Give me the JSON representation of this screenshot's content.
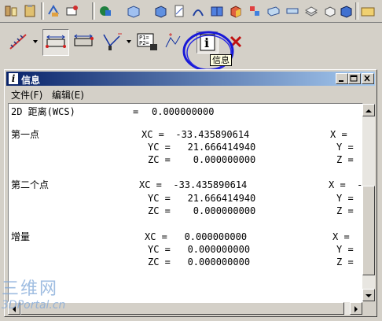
{
  "tooltip": {
    "text": "信息"
  },
  "window": {
    "title": "信息",
    "title_icon": "i",
    "menu": [
      "文件(F)",
      "编辑(E)"
    ]
  },
  "report": {
    "distance": {
      "label": "2D 距离(WCS)",
      "eq": "=",
      "value": "0.000000000"
    },
    "first_point": {
      "label": "第一点",
      "xc": "XC =  -33.435890614",
      "yc": "YC =   21.666414940",
      "zc": "ZC =    0.000000000",
      "x": "X =",
      "y": "Y =",
      "z": "Z ="
    },
    "second_point": {
      "label": "第二个点",
      "xc": "XC =  -33.435890614",
      "yc": "YC =   21.666414940",
      "zc": "ZC =    0.000000000",
      "x": "X =  -",
      "y": "Y =",
      "z": "Z ="
    },
    "delta": {
      "label": "增量",
      "xc": "XC =   0.000000000",
      "yc": "YC =   0.000000000",
      "zc": "ZC =   0.000000000",
      "x": "X =",
      "y": "Y =",
      "z": "Z ="
    }
  },
  "watermark": {
    "line1": "三维网",
    "line2": "3DPortal.cn"
  }
}
